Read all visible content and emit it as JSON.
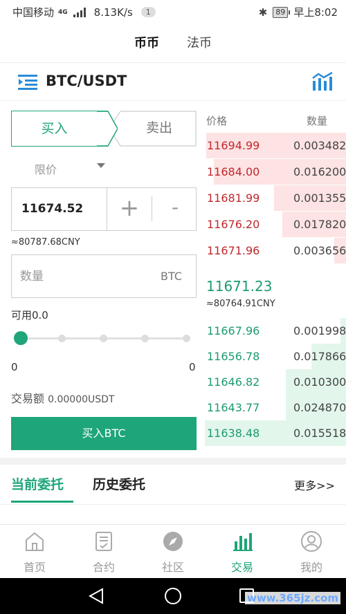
{
  "status_bar": {
    "carrier": "中国移动",
    "network": "4G",
    "speed": "8.13K/s",
    "notification_count": "1",
    "battery": "89",
    "time": "早上8:02"
  },
  "top_tabs": {
    "active": "币币",
    "inactive": "法币"
  },
  "pair": {
    "symbol": "BTC/USDT"
  },
  "trade_switch": {
    "buy": "买入",
    "sell": "卖出"
  },
  "order_type": {
    "selected": "限价"
  },
  "price_input": {
    "value": "11674.52",
    "plus": "+",
    "minus": "-",
    "cny_estimate": "≈80787.68CNY"
  },
  "quantity_input": {
    "placeholder": "数量",
    "unit": "BTC"
  },
  "available": "可用0.0",
  "slider": {
    "min_label": "0",
    "max_label": "0",
    "value": 0
  },
  "turnover": {
    "label": "交易额",
    "value": "0.00000USDT"
  },
  "buy_button": "买入BTC",
  "order_book": {
    "price_header": "价格",
    "qty_header": "数量",
    "asks": [
      {
        "price": "11694.99",
        "qty": "0.003482",
        "depth": 0.97
      },
      {
        "price": "11684.00",
        "qty": "0.016200",
        "depth": 0.92
      },
      {
        "price": "11681.99",
        "qty": "0.001355",
        "depth": 0.5
      },
      {
        "price": "11676.20",
        "qty": "0.017820",
        "depth": 0.44
      },
      {
        "price": "11671.96",
        "qty": "0.003656",
        "depth": 0.08
      }
    ],
    "last_price": "11671.23",
    "last_price_cny": "≈80764.91CNY",
    "bids": [
      {
        "price": "11667.96",
        "qty": "0.001998",
        "depth": 0.04
      },
      {
        "price": "11656.78",
        "qty": "0.017866",
        "depth": 0.24
      },
      {
        "price": "11646.82",
        "qty": "0.010300",
        "depth": 0.42
      },
      {
        "price": "11643.77",
        "qty": "0.024870",
        "depth": 0.42
      },
      {
        "price": "11638.48",
        "qty": "0.015518",
        "depth": 0.98
      }
    ]
  },
  "orders_tabs": {
    "current": "当前委托",
    "history": "历史委托",
    "more": "更多>>"
  },
  "bottom_nav": [
    {
      "label": "首页",
      "icon": "home-icon"
    },
    {
      "label": "合约",
      "icon": "contract-icon"
    },
    {
      "label": "社区",
      "icon": "community-icon"
    },
    {
      "label": "交易",
      "icon": "trade-icon"
    },
    {
      "label": "我的",
      "icon": "profile-icon"
    }
  ],
  "watermark": "www.365jz.com",
  "colors": {
    "accent": "#1ea57a",
    "ask": "#c0282d",
    "bid": "#1e9a72",
    "ask_bg": "#fde3e3",
    "bid_bg": "#e2f6ec"
  }
}
